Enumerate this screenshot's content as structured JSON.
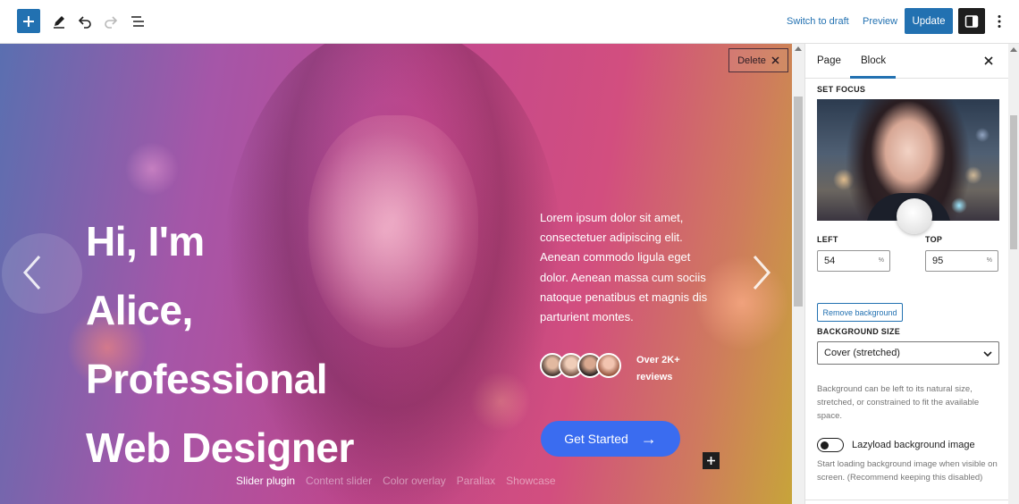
{
  "toolbar": {
    "add_icon": "plus-icon",
    "tools_icon": "pencil-icon",
    "undo_icon": "undo-icon",
    "redo_icon": "redo-icon",
    "list_view_icon": "list-view-icon",
    "switch_to_draft_label": "Switch to draft",
    "preview_label": "Preview",
    "update_label": "Update",
    "settings_icon": "sidebar-toggle-icon",
    "options_icon": "more-vertical-icon",
    "accent_color": "#2271b1"
  },
  "hero": {
    "delete_label": "Delete",
    "headline": [
      "Hi, I'm",
      "Alice,",
      "Professional",
      "Web Designer"
    ],
    "paragraph": "Lorem ipsum dolor sit amet, consectetuer adipiscing elit. Aenean commodo ligula eget dolor. Aenean massa cum sociis natoque penatibus et magnis dis parturient montes.",
    "reviews_label": "Over 2K+ reviews",
    "cta_label": "Get Started",
    "cta_arrow": "→",
    "cta_color": "#3a6cf0",
    "tags": [
      {
        "label": "Slider plugin",
        "active": true
      },
      {
        "label": "Content slider",
        "active": false
      },
      {
        "label": "Color overlay",
        "active": false
      },
      {
        "label": "Parallax",
        "active": false
      },
      {
        "label": "Showcase",
        "active": false
      }
    ]
  },
  "sidebar": {
    "tabs": [
      {
        "label": "Page",
        "active": false
      },
      {
        "label": "Block",
        "active": true
      }
    ],
    "set_focus_label": "SET FOCUS",
    "left_label": "LEFT",
    "left_value": "54",
    "top_label": "TOP",
    "top_value": "95",
    "unit": "%",
    "remove_background_label": "Remove background",
    "background_size_label": "BACKGROUND SIZE",
    "background_size_value": "Cover (stretched)",
    "background_size_help": "Background can be left to its natural size, stretched, or constrained to fit the available space.",
    "lazyload_label": "Lazyload background image",
    "lazyload_enabled": false,
    "lazyload_help": "Start loading background image when visible on screen. (Recommend keeping this disabled)"
  }
}
